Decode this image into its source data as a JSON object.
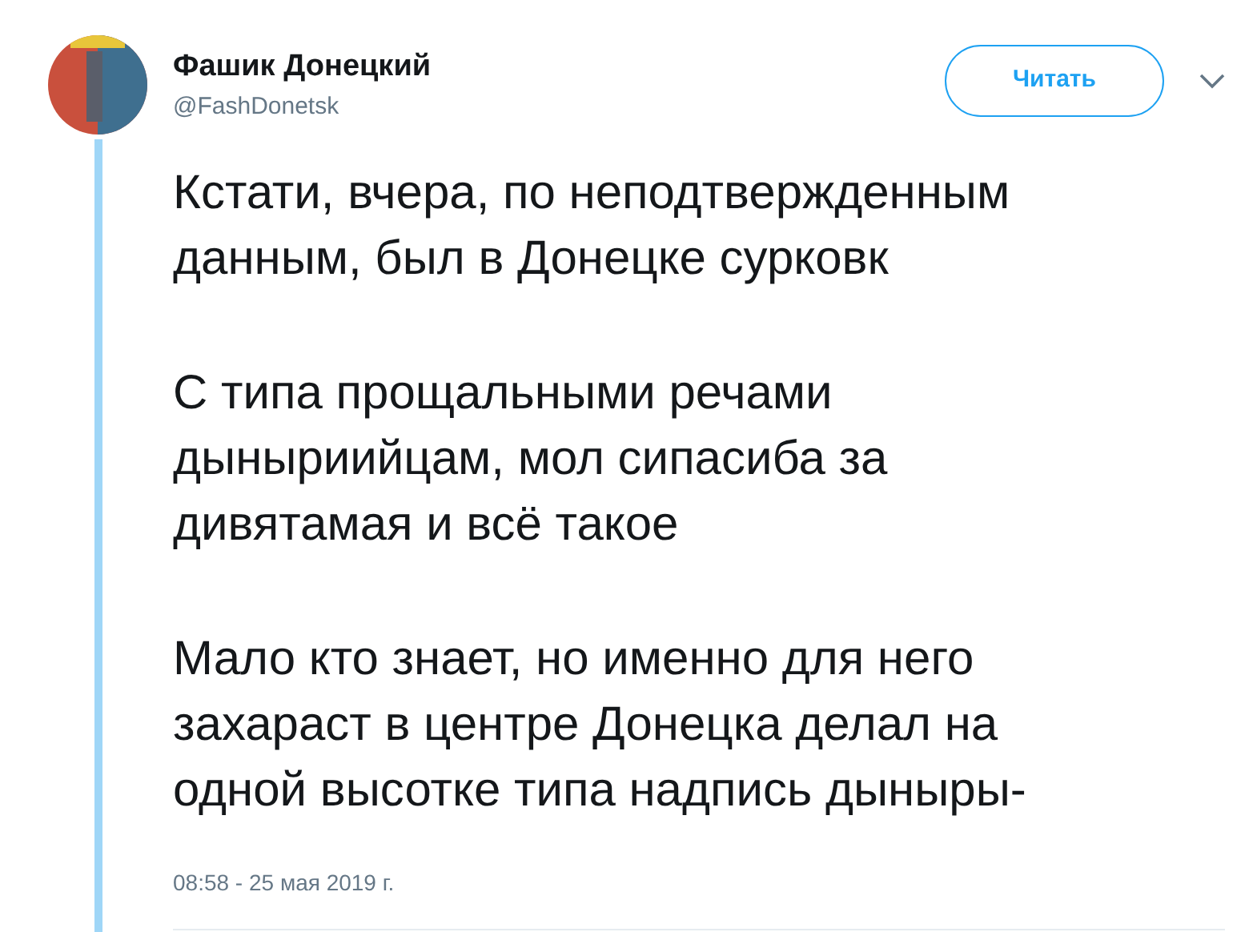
{
  "author": {
    "name": "Фашик Донецкий",
    "handle": "@FashDonetsk"
  },
  "follow_button": "Читать",
  "paragraphs": [
    [
      "Кстати, вчера, по неподтвержденным",
      "данным, был в Донецке сурковк"
    ],
    [
      "С типа прощальными речами",
      "дыныриийцам, мол сипасиба за",
      "дивятамая и всё такое"
    ],
    [
      "Мало кто знает, но именно для него",
      "захараст в центре Донецка делал на",
      "одной высотке типа надпись дыныры-"
    ]
  ],
  "timestamp": "08:58 - 25 мая 2019 г."
}
